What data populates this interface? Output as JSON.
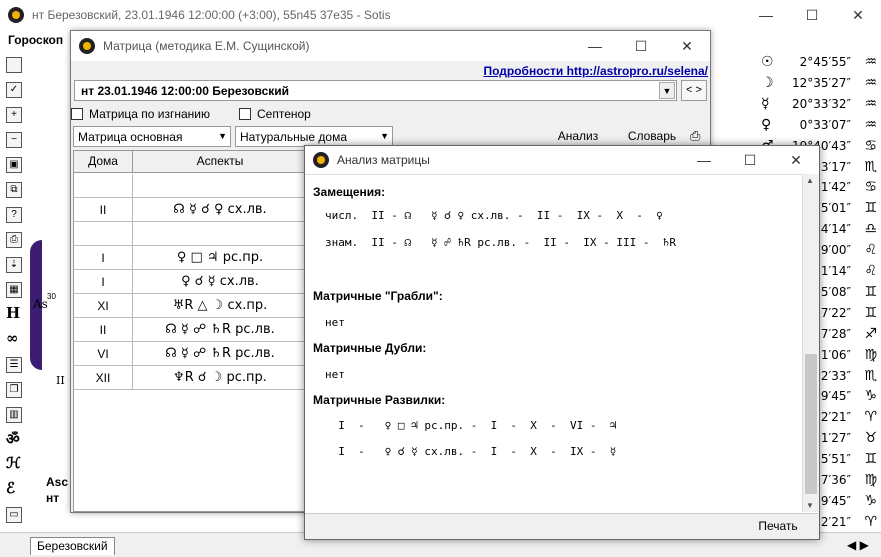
{
  "main_window": {
    "title": "нт Березовский, 23.01.1946 12:00:00 (+3:00), 55n45 37e35 - Sotis",
    "minimize": "—",
    "maximize": "☐",
    "close": "✕"
  },
  "menu": {
    "horoscope": "Гороскоп"
  },
  "chart": {
    "asc_label": "As",
    "asc_degree": "30",
    "house2_label": "II",
    "house2_sup": "2",
    "bottom_asc": "Asc",
    "bottom_name": "нт"
  },
  "planets": [
    {
      "glyph": "☉",
      "retro": "",
      "degree": "2°45′55″",
      "sign": "♒"
    },
    {
      "glyph": "☽",
      "retro": "",
      "degree": "12°35′27″",
      "sign": "♒"
    },
    {
      "glyph": "☿",
      "retro": "",
      "degree": "20°33′32″",
      "sign": "♒"
    },
    {
      "glyph": "♀",
      "retro": "",
      "degree": "0°33′07″",
      "sign": "♒"
    },
    {
      "glyph": "♂",
      "retro": "R",
      "degree": "19°40′43″",
      "sign": "♋"
    },
    {
      "glyph": "",
      "retro": "",
      "degree": "3′17″",
      "sign": "♏"
    },
    {
      "glyph": "",
      "retro": "",
      "degree": "1′42″",
      "sign": "♋"
    },
    {
      "glyph": "",
      "retro": "",
      "degree": "5′01″",
      "sign": "♊"
    },
    {
      "glyph": "",
      "retro": "",
      "degree": "4′14″",
      "sign": "♎"
    },
    {
      "glyph": "",
      "retro": "",
      "degree": "9′00″",
      "sign": "♌"
    },
    {
      "glyph": "",
      "retro": "",
      "degree": "1′14″",
      "sign": "♌"
    },
    {
      "glyph": "",
      "retro": "",
      "degree": "5′08″",
      "sign": "♊"
    },
    {
      "glyph": "",
      "retro": "",
      "degree": "7′22″",
      "sign": "♊"
    },
    {
      "glyph": "",
      "retro": "",
      "degree": "7′28″",
      "sign": "♐"
    },
    {
      "glyph": "",
      "retro": "",
      "degree": "1′06″",
      "sign": "♍"
    },
    {
      "glyph": "",
      "retro": "",
      "degree": "2′33″",
      "sign": "♏"
    },
    {
      "glyph": "",
      "retro": "",
      "degree": "9′45″",
      "sign": "♑"
    },
    {
      "glyph": "",
      "retro": "",
      "degree": "2′21″",
      "sign": "♈"
    },
    {
      "glyph": "",
      "retro": "",
      "degree": "1′27″",
      "sign": "♉"
    },
    {
      "glyph": "",
      "retro": "",
      "degree": "5′51″",
      "sign": "♊"
    },
    {
      "glyph": "",
      "retro": "",
      "degree": "7′36″",
      "sign": "♍"
    },
    {
      "glyph": "",
      "retro": "",
      "degree": "9′45″",
      "sign": "♑"
    },
    {
      "glyph": "",
      "retro": "",
      "degree": "2′21″",
      "sign": "♈"
    }
  ],
  "bottom_tab": "Березовский",
  "matrix_window": {
    "title": "Матрица (методика Е.М. Сущинской)",
    "link": "Подробности http://astropro.ru/selena/",
    "combo_value": "нт 23.01.1946 12:00:00 Березовский",
    "nav": "< >",
    "chk_exile": "Матрица по изгнанию",
    "chk_septenor": "Септенор",
    "dd_matrix": "Матрица основная",
    "dd_houses": "Натуральные дома",
    "btn_analysis": "Анализ",
    "btn_dictionary": "Словарь",
    "table": {
      "col_houses": "Дома",
      "col_aspects": "Аспекты",
      "rows": [
        {
          "house": "",
          "aspect": ""
        },
        {
          "house": "II",
          "aspect": "☊ ☿ ☌ ♀ сх.лв."
        },
        {
          "house": "",
          "aspect": ""
        },
        {
          "house": "I",
          "aspect": "♀ □ ♃ рс.пр."
        },
        {
          "house": "I",
          "aspect": "♀ ☌ ☿ сх.лв."
        },
        {
          "house": "XI",
          "aspect": "♅R △ ☽ сх.пр."
        },
        {
          "house": "II",
          "aspect": "☊ ☿ ☍ ♄R рс.лв."
        },
        {
          "house": "VI",
          "aspect": "☊ ☿ ☍ ♄R рс.лв."
        },
        {
          "house": "XII",
          "aspect": "♆R ☌ ☽ рс.пр."
        }
      ]
    }
  },
  "analysis_window": {
    "title": "Анализ матрицы",
    "h_substitutions": "Замещения:",
    "line_num": "числ.  II - ☊   ☿ ☌ ♀ сх.лв. -  II -  IX -  X  -  ♀",
    "line_den": "знам.  II - ☊   ☿ ☍ ♄R рс.лв. -  II -  IX - III -  ♄R",
    "h_rakes": "Матричные \"Грабли\":",
    "rakes_value": "нет",
    "h_doubles": "Матричные Дубли:",
    "doubles_value": "нет",
    "h_forks": "Матричные Развилки:",
    "fork1": "  I  -   ♀ □ ♃ рс.пр. -  I  -  X  -  VI -  ♃",
    "fork2": "  I  -   ♀ ☌ ☿ сх.лв. -  I  -  X  -  IX -  ☿",
    "print": "Печать"
  }
}
